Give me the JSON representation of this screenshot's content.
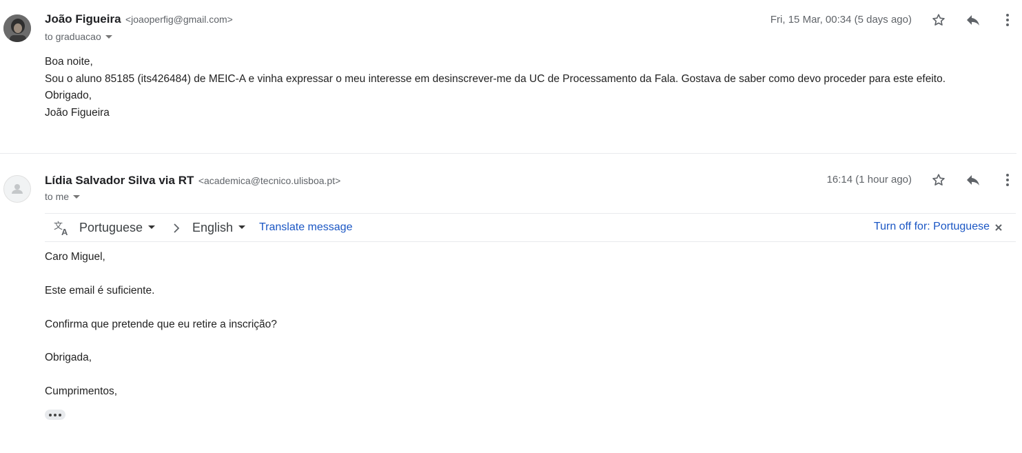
{
  "messages": [
    {
      "sender_name": "João Figueira",
      "sender_email": "<joaoperfig@gmail.com>",
      "to": "to graduacao",
      "time": "Fri, 15 Mar, 00:34 (5 days ago)",
      "body_lines": [
        "Boa noite,",
        "Sou o aluno 85185 (its426484) de MEIC-A e vinha expressar o meu interesse em desinscrever-me da UC de Processamento da Fala. Gostava de saber como devo proceder para este efeito.",
        "Obrigado,",
        "João Figueira"
      ]
    },
    {
      "sender_name": "Lídia Salvador Silva via RT",
      "sender_email": "<academica@tecnico.ulisboa.pt>",
      "to": "to me",
      "time": "16:14 (1 hour ago)",
      "translate_bar": {
        "source_language": "Portuguese",
        "target_language": "English",
        "translate_link": "Translate message",
        "turn_off_link": "Turn off for: Portuguese"
      },
      "body_lines": [
        "Caro Miguel,",
        "",
        "Este email é suficiente.",
        "",
        "Confirma que pretende que eu retire a inscrição?",
        "",
        "Obrigada,",
        "",
        "Cumprimentos,"
      ]
    }
  ],
  "icons": {
    "star": "star-outline-icon",
    "reply": "reply-icon",
    "more": "more-vert-icon",
    "translate": "translate-icon",
    "close": "close-icon",
    "ellipsis": "show-trimmed-content-icon"
  },
  "colors": {
    "link": "#1a56c4",
    "secondary_text": "#5f6368",
    "divider": "#e8eaed"
  }
}
